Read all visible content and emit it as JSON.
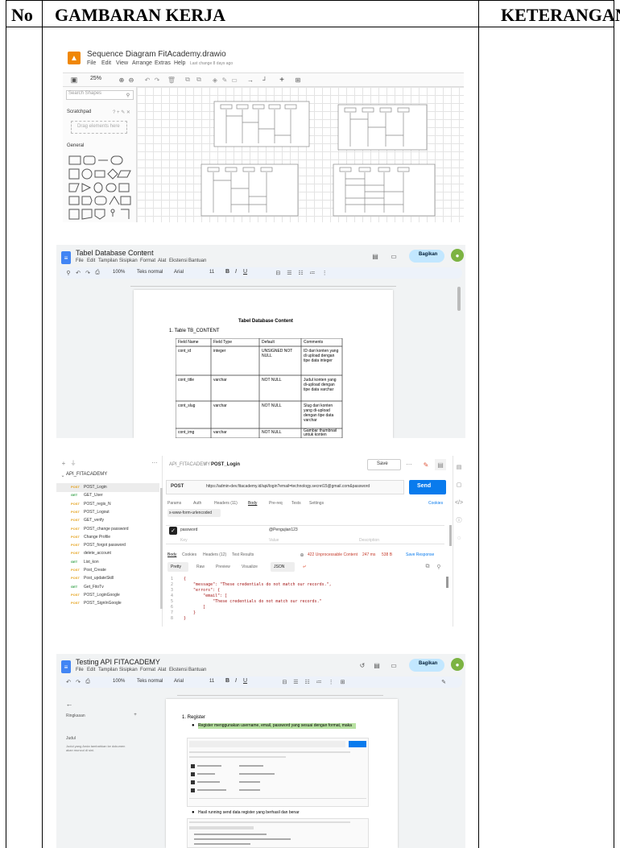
{
  "header": {
    "no": "No",
    "gambaran": "GAMBARAN KERJA",
    "keterangan": "KETERANGAN"
  },
  "shot1": {
    "title": "Sequence Diagram FitAcademy.drawio",
    "menu": [
      "File",
      "Edit",
      "View",
      "Arrange",
      "Extras",
      "Help"
    ],
    "last_change": "Last change 8 days ago",
    "zoom": "25%",
    "search_placeholder": "Search Shapes",
    "scratchpad": "Scratchpad",
    "drag_hint": "Drag elements here",
    "general": "General"
  },
  "shot2": {
    "doc_title": "Tabel Database Content",
    "menu": [
      "File",
      "Edit",
      "Tampilan",
      "Sisipkan",
      "Format",
      "Alat",
      "Ekstensi",
      "Bantuan"
    ],
    "share_label": "Bagikan",
    "zoom": "100%",
    "style": "Teks normal",
    "font": "Arial",
    "font_size": "11",
    "heading": "Tabel Database Content",
    "subheading": "1.  Table  TB_CONTENT",
    "columns": [
      "Field Name",
      "Field Type",
      "Default",
      "Comments"
    ],
    "rows": [
      [
        "cont_id",
        "integer",
        "UNSIGNED NOT NULL",
        "ID dari konten yang di upload dengan tipe data integer"
      ],
      [
        "cont_title",
        "varchar",
        "NOT NULL",
        "Judul konten yang di-upload dengan tipe data varchar"
      ],
      [
        "cont_slug",
        "varchar",
        "NOT NULL",
        "Slug dari konten yang di-upload dengan tipe data varchar"
      ],
      [
        "cont_img",
        "varchar",
        "NOT NULL",
        "Gambar thumbnail untuk konten"
      ]
    ]
  },
  "shot3": {
    "collection": "API_FITACADEMY",
    "breadcrumb_root": "API_FITACADEMY",
    "breadcrumb_leaf": "POST_Login",
    "save_label": "Save",
    "method": "POST",
    "url": "https://admin-dev.fitacademy.id/api/login?email=technology.secret15@gmail.com&password",
    "send_label": "Send",
    "request_tabs": [
      "Params",
      "Auth",
      "Headers (11)",
      "Body",
      "Pre-req",
      "Tests",
      "Settings"
    ],
    "cookies_label": "Cookies",
    "body_mode": "x-www-form-urlencoded",
    "form_key": "password",
    "form_value": "@Pengujian123",
    "key_placeholder": "Key",
    "value_placeholder": "Value",
    "description_placeholder": "Description",
    "response_tabs": [
      "Body",
      "Cookies",
      "Headers (12)",
      "Test Results"
    ],
    "status": "422 Unprocessable Content",
    "time": "247 ms",
    "size": "538 B",
    "save_response": "Save Response",
    "view_tabs": [
      "Pretty",
      "Raw",
      "Preview",
      "Visualize"
    ],
    "format": "JSON",
    "sidebar_items": [
      {
        "method": "POST",
        "name": "POST_Login"
      },
      {
        "method": "GET",
        "name": "GET_User"
      },
      {
        "method": "POST",
        "name": "POST_regis_N"
      },
      {
        "method": "POST",
        "name": "POST_Logout"
      },
      {
        "method": "POST",
        "name": "GET_verify"
      },
      {
        "method": "POST",
        "name": "POST_change password"
      },
      {
        "method": "POST",
        "name": "Change Profile"
      },
      {
        "method": "POST",
        "name": "POST_forgot password"
      },
      {
        "method": "POST",
        "name": "delete_account"
      },
      {
        "method": "GET",
        "name": "List_kon"
      },
      {
        "method": "POST",
        "name": "Post_Create"
      },
      {
        "method": "POST",
        "name": "Post_updateSkill"
      },
      {
        "method": "GET",
        "name": "Get_FitoTv"
      },
      {
        "method": "POST",
        "name": "POST_LoginGoogle"
      },
      {
        "method": "POST",
        "name": "POST_SignInGoogle"
      }
    ],
    "code_lines": [
      {
        "n": "1",
        "text": "{"
      },
      {
        "n": "2",
        "text": "    \"message\": \"These credentials do not match our records.\","
      },
      {
        "n": "3",
        "text": "    \"errors\": {"
      },
      {
        "n": "4",
        "text": "        \"email\": ["
      },
      {
        "n": "5",
        "text": "            \"These credentials do not match our records.\""
      },
      {
        "n": "6",
        "text": "        ]"
      },
      {
        "n": "7",
        "text": "    }"
      },
      {
        "n": "8",
        "text": "}"
      }
    ]
  },
  "shot4": {
    "doc_title": "Testing API FITACADEMY",
    "menu": [
      "File",
      "Edit",
      "Tampilan",
      "Sisipkan",
      "Format",
      "Alat",
      "Ekstensi",
      "Bantuan"
    ],
    "share_label": "Bagikan",
    "zoom": "100%",
    "style": "Teks normal",
    "font": "Arial",
    "font_size": "11",
    "outline_title": "Ringkasan",
    "outline_heading": "Judul",
    "outline_hint": "Judul yang Anda tambahkan ke dokumen akan muncul di sini.",
    "list_item": "1.  Register",
    "bullet1": "Register menggunakan username, email, password yang sesuai dengan format, maka",
    "bullet2": "Hasil running send data register yang berhasil dan benar"
  }
}
